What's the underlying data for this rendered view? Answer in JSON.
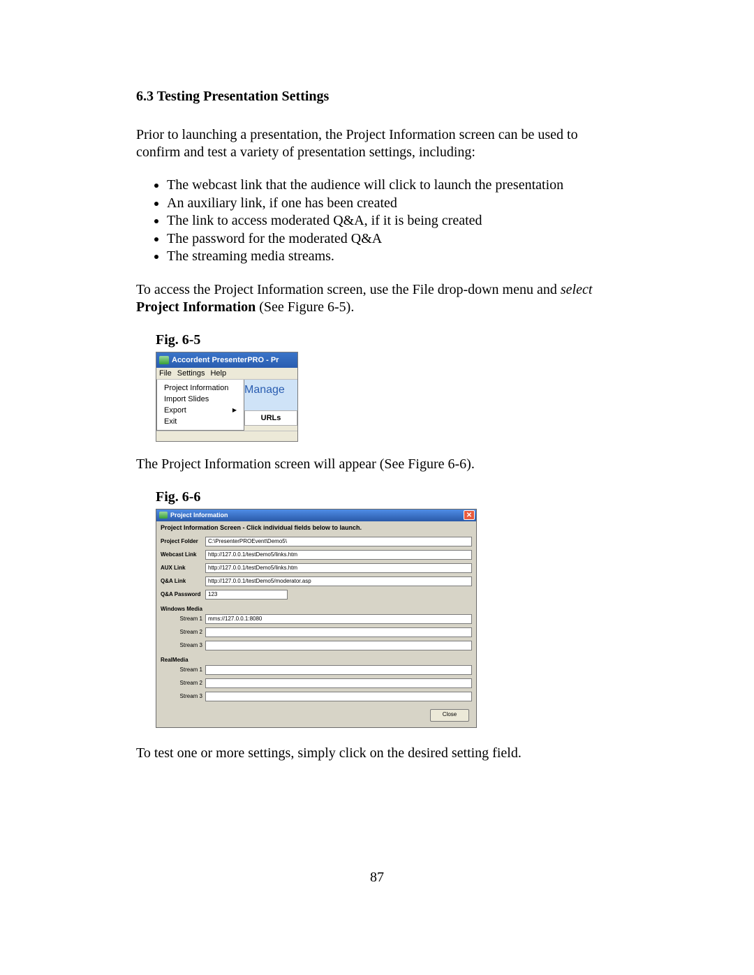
{
  "heading": "6.3 Testing Presentation Settings",
  "para1": "Prior to launching a presentation, the Project Information screen can be used to confirm and test a variety of presentation settings, including:",
  "bullets": [
    "The webcast link that the audience will click to launch the presentation",
    "An auxiliary link, if one has been created",
    "The link to access moderated Q&A, if it is being created",
    "The password for the moderated Q&A",
    "The streaming media streams."
  ],
  "para2a": "To access the Project Information screen, use the File drop-down menu and ",
  "para2b_italic": "select",
  "para2c_bold": "Project Information",
  "para2d": " (See Figure 6-5).",
  "figLabel65": "Fig. 6-5",
  "fig65": {
    "title": "Accordent PresenterPRO - Pr",
    "menubar": {
      "file": "File",
      "settings": "Settings",
      "help": "Help"
    },
    "menu": {
      "projectInfo": "Project Information",
      "importSlides": "Import Slides",
      "export": "Export",
      "exit": "Exit"
    },
    "manager": "Manage",
    "urls": "URLs"
  },
  "para3": "The Project Information screen will appear (See Figure 6-6).",
  "figLabel66": "Fig. 6-6",
  "fig66": {
    "title": "Project Information",
    "instruction": "Project Information Screen - Click individual fields below to launch.",
    "labels": {
      "projectFolder": "Project Folder",
      "webcastLink": "Webcast Link",
      "auxLink": "AUX Link",
      "qaLink": "Q&A Link",
      "qaPassword": "Q&A Password",
      "windowsMedia": "Windows Media",
      "stream1": "Stream 1",
      "stream2": "Stream 2",
      "stream3": "Stream 3",
      "realMedia": "RealMedia",
      "close": "Close"
    },
    "values": {
      "projectFolder": "C:\\PresenterPROEvent\\Demo5\\",
      "webcastLink": "http://127.0.0.1/testDemo5/links.htm",
      "auxLink": "http://127.0.0.1/testDemo5/links.htm",
      "qaLink": "http://127.0.0.1/testDemo5/moderator.asp",
      "qaPassword": "123",
      "wmStream1": "mms://127.0.0.1:8080",
      "wmStream2": "",
      "wmStream3": "",
      "rmStream1": "",
      "rmStream2": "",
      "rmStream3": ""
    }
  },
  "para4": "To test one or more settings, simply click on the desired setting field.",
  "pageNumber": "87"
}
